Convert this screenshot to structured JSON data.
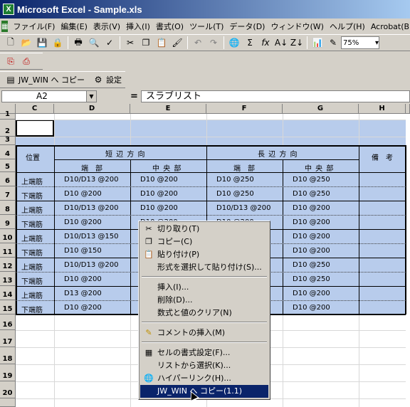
{
  "window": {
    "title": "Microsoft Excel - Sample.xls",
    "app_icon": "X"
  },
  "menu": [
    "ファイル(F)",
    "編集(E)",
    "表示(V)",
    "挿入(I)",
    "書式(O)",
    "ツール(T)",
    "データ(D)",
    "ウィンドウ(W)",
    "ヘルプ(H)",
    "Acrobat(B)"
  ],
  "toolbar": {
    "zoom": "75%",
    "jw_label": "JW_WIN へ コピー",
    "settings_label": "設定"
  },
  "formula": {
    "name_box": "A2",
    "eq": "=",
    "content": "スラブリスト"
  },
  "columns": [
    "C",
    "D",
    "E",
    "F",
    "G",
    "H"
  ],
  "rows": [
    "1",
    "2",
    "3",
    "4",
    "5",
    "6",
    "7",
    "8",
    "9",
    "10",
    "11",
    "12",
    "13",
    "14",
    "15",
    "16",
    "17",
    "18",
    "19",
    "20"
  ],
  "table": {
    "col_position": "位置",
    "short_dir": "短 辺 方 向",
    "long_dir": "長 辺 方 向",
    "remarks": "備　考",
    "end": "端　部",
    "center": "中 央 部",
    "rows": [
      [
        "上端筋",
        "D10/D13 @200",
        "D10 @200",
        "D10 @250",
        "D10 @250"
      ],
      [
        "下端筋",
        "D10 @200",
        "D10 @200",
        "D10 @250",
        "D10 @250"
      ],
      [
        "上端筋",
        "D10/D13 @200",
        "D10 @200",
        "D10/D13 @200",
        "D10 @200"
      ],
      [
        "下端筋",
        "D10 @200",
        "D10 @200",
        "D10 @200",
        "D10 @200"
      ],
      [
        "上端筋",
        "D10/D13 @150",
        "",
        "",
        "D10 @200"
      ],
      [
        "下端筋",
        "D10 @150",
        "",
        "",
        "D10 @200"
      ],
      [
        "上端筋",
        "D10/D13 @200",
        "",
        "",
        "D10 @250"
      ],
      [
        "下端筋",
        "D10 @200",
        "",
        "",
        "D10 @250"
      ],
      [
        "上端筋",
        "D13 @200",
        "",
        "",
        "D10 @200"
      ],
      [
        "下端筋",
        "D10 @200",
        "",
        "",
        "D10 @200"
      ]
    ]
  },
  "context_menu": [
    {
      "label": "切り取り(T)",
      "icon": "scissors-icon"
    },
    {
      "label": "コピー(C)",
      "icon": "copy-icon"
    },
    {
      "label": "貼り付け(P)",
      "icon": "paste-icon"
    },
    {
      "label": "形式を選択して貼り付け(S)...",
      "icon": ""
    },
    {
      "label": "挿入(I)...",
      "icon": ""
    },
    {
      "label": "削除(D)...",
      "icon": ""
    },
    {
      "label": "数式と値のクリア(N)",
      "icon": ""
    },
    {
      "label": "コメントの挿入(M)",
      "icon": "comment-icon"
    },
    {
      "label": "セルの書式設定(F)...",
      "icon": "format-cells-icon"
    },
    {
      "label": "リストから選択(K)...",
      "icon": ""
    },
    {
      "label": "ハイパーリンク(H)...",
      "icon": "globe-icon"
    },
    {
      "label": "JW_WIN へ コピー(1.1)",
      "icon": ""
    }
  ],
  "colors": {
    "selection": "#b8ccec",
    "highlight": "#0a246a"
  }
}
